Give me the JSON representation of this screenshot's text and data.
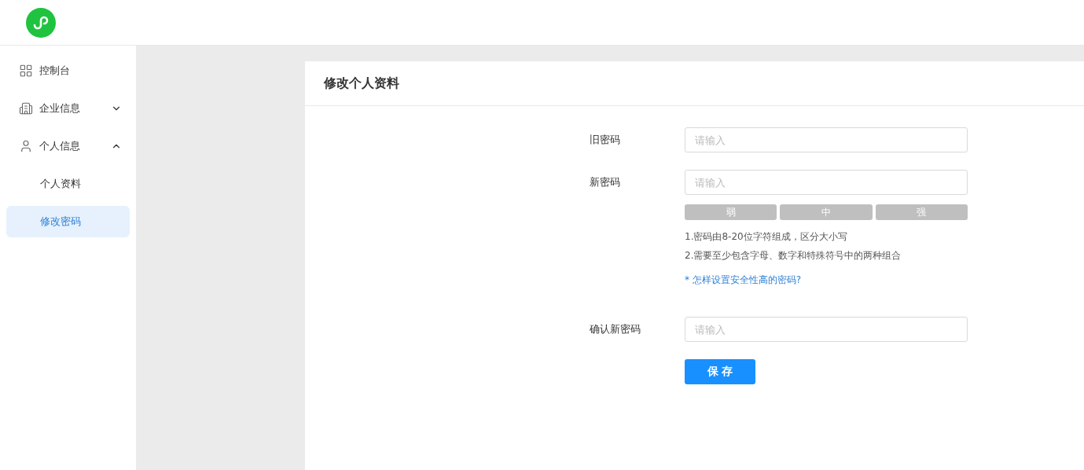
{
  "sidebar": {
    "items": [
      {
        "kind": "link",
        "label": "控制台",
        "selected": false
      },
      {
        "kind": "group",
        "label": "企业信息",
        "expanded": false
      },
      {
        "kind": "group",
        "label": "个人信息",
        "expanded": true,
        "children": [
          {
            "label": "个人资料",
            "selected": false
          },
          {
            "label": "修改密码",
            "selected": true
          }
        ]
      }
    ]
  },
  "card": {
    "title": "修改个人资料",
    "fields": [
      {
        "kind": "input",
        "label": "旧密码",
        "placeholder": "请输入"
      },
      {
        "kind": "input",
        "label": "新密码",
        "placeholder": "请输入",
        "strength": [
          {
            "label": "弱",
            "active": false
          },
          {
            "label": "中",
            "active": false
          },
          {
            "label": "强",
            "active": false
          }
        ],
        "hints": [
          "1.密码由8-20位字符组成，区分大小写",
          "2.需要至少包含字母、数字和特殊符号中的两种组合"
        ],
        "link": "* 怎样设置安全性高的密码?"
      },
      {
        "kind": "input",
        "label": "确认新密码",
        "placeholder": "请输入"
      }
    ],
    "button": "保 存"
  }
}
